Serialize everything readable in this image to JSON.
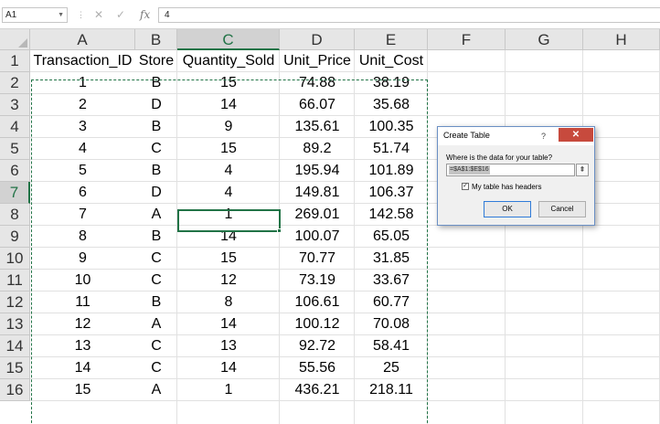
{
  "formula_bar": {
    "name_box": "A1",
    "cancel_glyph": "✕",
    "enter_glyph": "✓",
    "fx_label": "fx",
    "formula_value": "4"
  },
  "grid": {
    "columns": [
      "A",
      "B",
      "C",
      "D",
      "E",
      "F",
      "G",
      "H"
    ],
    "rows": [
      "1",
      "2",
      "3",
      "4",
      "5",
      "6",
      "7",
      "8",
      "9",
      "10",
      "11",
      "12",
      "13",
      "14",
      "15",
      "16"
    ],
    "selected_column": "C",
    "selected_row": "7",
    "headers": [
      "Transaction_ID",
      "Store",
      "Quantity_Sold",
      "Unit_Price",
      "Unit_Cost"
    ],
    "data": [
      [
        "1",
        "B",
        "15",
        "74.88",
        "38.19"
      ],
      [
        "2",
        "D",
        "14",
        "66.07",
        "35.68"
      ],
      [
        "3",
        "B",
        "9",
        "135.61",
        "100.35"
      ],
      [
        "4",
        "C",
        "15",
        "89.2",
        "51.74"
      ],
      [
        "5",
        "B",
        "4",
        "195.94",
        "101.89"
      ],
      [
        "6",
        "D",
        "4",
        "149.81",
        "106.37"
      ],
      [
        "7",
        "A",
        "1",
        "269.01",
        "142.58"
      ],
      [
        "8",
        "B",
        "14",
        "100.07",
        "65.05"
      ],
      [
        "9",
        "C",
        "15",
        "70.77",
        "31.85"
      ],
      [
        "10",
        "C",
        "12",
        "73.19",
        "33.67"
      ],
      [
        "11",
        "B",
        "8",
        "106.61",
        "60.77"
      ],
      [
        "12",
        "A",
        "14",
        "100.12",
        "70.08"
      ],
      [
        "13",
        "C",
        "13",
        "92.72",
        "58.41"
      ],
      [
        "14",
        "C",
        "14",
        "55.56",
        "25"
      ],
      [
        "15",
        "A",
        "1",
        "436.21",
        "218.11"
      ]
    ]
  },
  "dialog": {
    "title": "Create Table",
    "help_glyph": "?",
    "close_glyph": "✕",
    "prompt": "Where is the data for your table?",
    "range_value": "=$A$1:$E$16",
    "collapse_glyph": "⇞",
    "checkbox_glyph": "✓",
    "headers_label": "My table has headers",
    "ok_label": "OK",
    "cancel_label": "Cancel"
  },
  "colors": {
    "accent": "#217346",
    "close_button": "#c74a3d",
    "header_bg": "#e6e6e6"
  }
}
